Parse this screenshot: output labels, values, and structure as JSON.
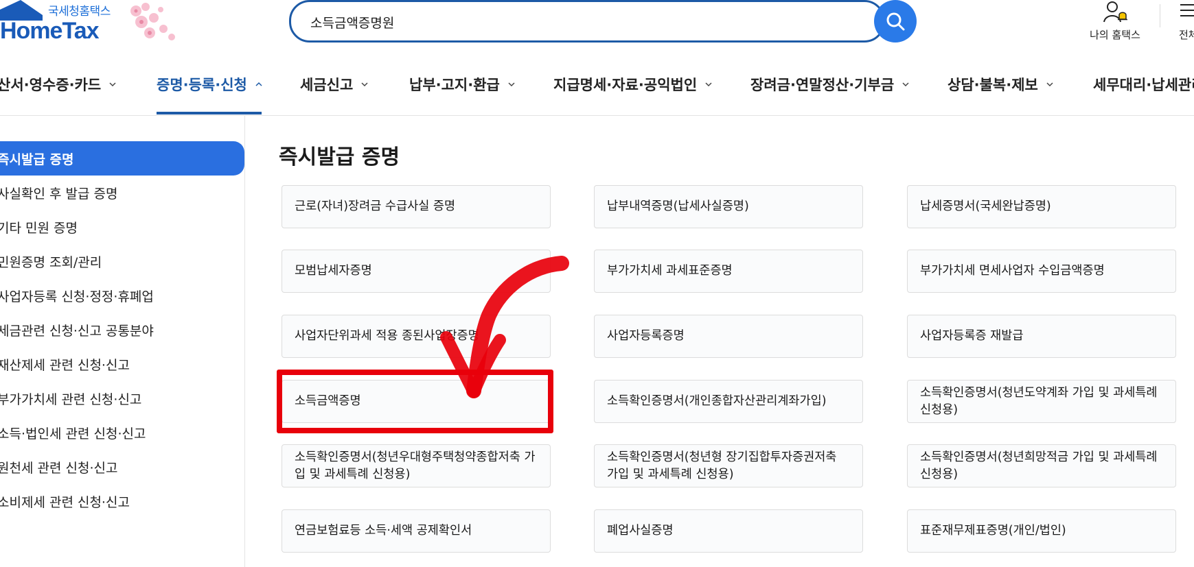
{
  "header": {
    "logo_sub": "국세청홈택스",
    "logo_main": "HomeTax",
    "search_value": "소득금액증명원",
    "my_hometax": "나의 홈택스",
    "all_menu": "전체"
  },
  "gnb": {
    "items": [
      {
        "label": "산서·영수증·카드"
      },
      {
        "label": "증명·등록·신청"
      },
      {
        "label": "세금신고"
      },
      {
        "label": "납부·고지·환급"
      },
      {
        "label": "지급명세·자료·공익법인"
      },
      {
        "label": "장려금·연말정산·기부금"
      },
      {
        "label": "상담·불복·제보"
      },
      {
        "label": "세무대리·납세관리"
      }
    ]
  },
  "sidebar": {
    "items": [
      {
        "label": "즉시발급 증명"
      },
      {
        "label": "사실확인 후 발급 증명"
      },
      {
        "label": "기타 민원 증명"
      },
      {
        "label": "민원증명 조회/관리"
      },
      {
        "label": "사업자등록 신청·정정·휴폐업"
      },
      {
        "label": "세금관련 신청·신고 공통분야"
      },
      {
        "label": "재산제세 관련 신청·신고"
      },
      {
        "label": "부가가치세 관련 신청·신고"
      },
      {
        "label": "소득·법인세 관련 신청·신고"
      },
      {
        "label": "원천세 관련 신청·신고"
      },
      {
        "label": "소비제세 관련 신청·신고"
      }
    ]
  },
  "content": {
    "title": "즉시발급 증명",
    "cards": [
      {
        "label": "근로(자녀)장려금 수급사실 증명"
      },
      {
        "label": "납부내역증명(납세사실증명)"
      },
      {
        "label": "납세증명서(국세완납증명)"
      },
      {
        "label": "모범납세자증명"
      },
      {
        "label": "부가가치세 과세표준증명"
      },
      {
        "label": "부가가치세 면세사업자 수입금액증명"
      },
      {
        "label": "사업자단위과세 적용 종된사업장증명"
      },
      {
        "label": "사업자등록증명"
      },
      {
        "label": "사업자등록증 재발급"
      },
      {
        "label": "소득금액증명"
      },
      {
        "label": "소득확인증명서(개인종합자산관리계좌가입)"
      },
      {
        "label": "소득확인증명서(청년도약계좌 가입 및 과세특례 신청용)"
      },
      {
        "label": "소득확인증명서(청년우대형주택청약종합저축 가입 및 과세특례 신청용)"
      },
      {
        "label": "소득확인증명서(청년형 장기집합투자증권저축 가입 및 과세특례 신청용)"
      },
      {
        "label": "소득확인증명서(청년희망적금 가입 및 과세특례 신청용)"
      },
      {
        "label": "연금보험료등 소득·세액 공제확인서"
      },
      {
        "label": "폐업사실증명"
      },
      {
        "label": "표준재무제표증명(개인/법인)"
      }
    ]
  },
  "colors": {
    "brand_blue": "#1d5aa6",
    "active_blue": "#2a6fe0",
    "annotation_red": "#e8000b"
  },
  "icons": {
    "search": "search-icon",
    "my_hometax": "person-bell-icon",
    "all_menu": "menu-icon",
    "dropdown": "chevron-down-icon",
    "dropdown_open": "chevron-up-icon"
  }
}
